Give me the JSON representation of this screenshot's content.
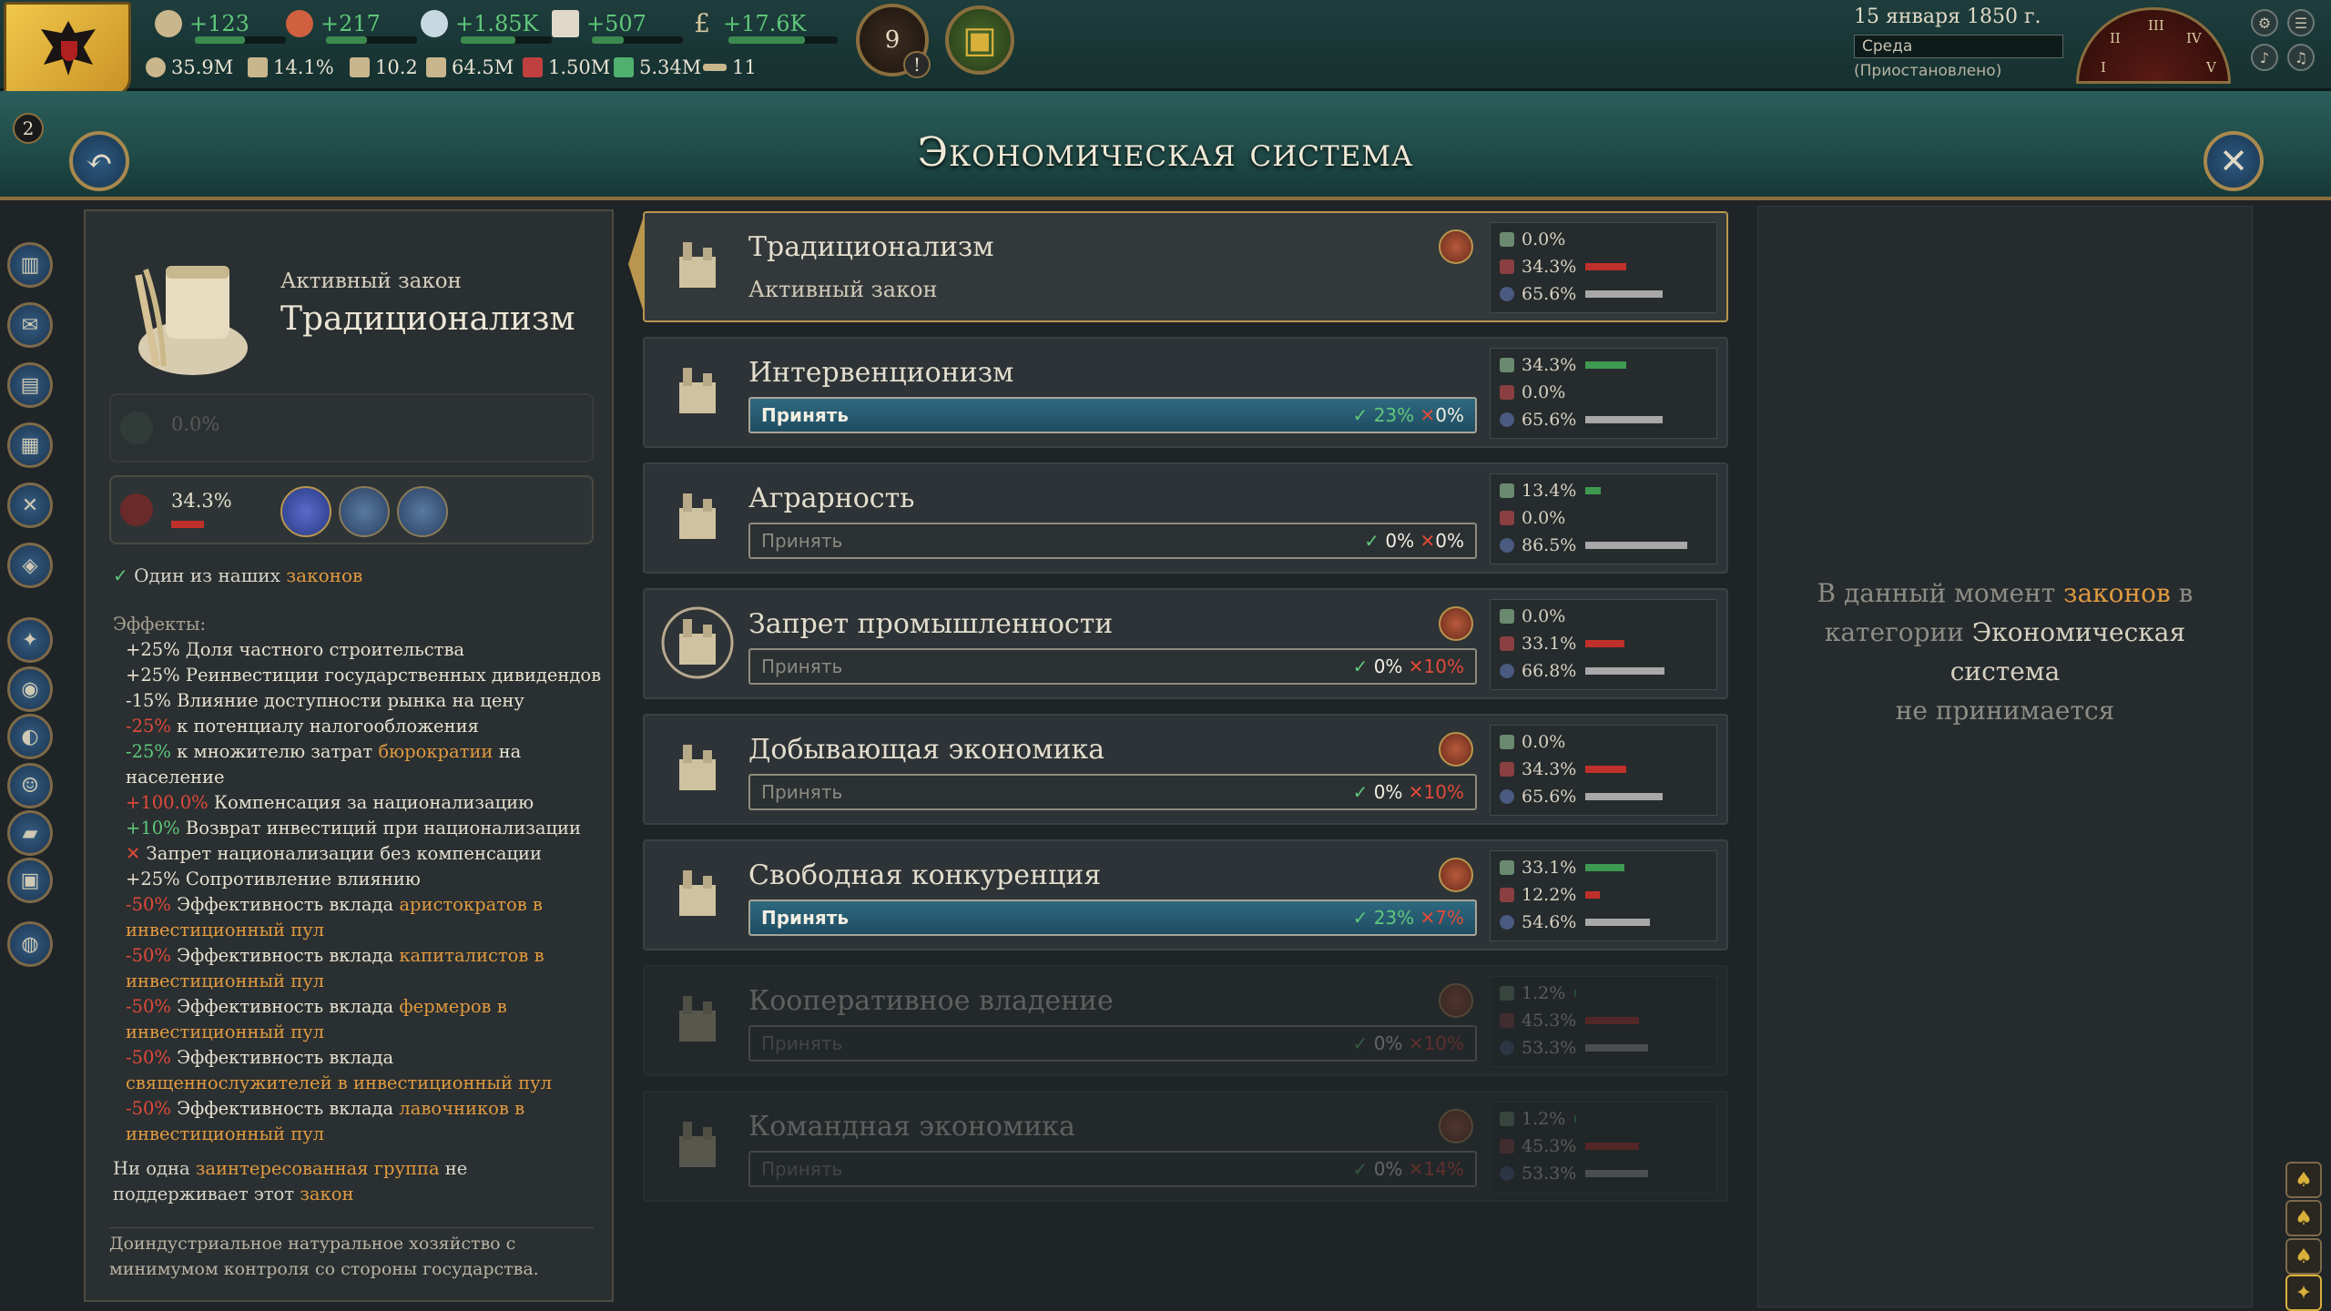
{
  "topbar": {
    "resources": [
      {
        "name": "authority-icon",
        "value": "+123"
      },
      {
        "name": "influence-icon",
        "value": "+217"
      },
      {
        "name": "diplomacy-icon",
        "value": "+1.85K"
      },
      {
        "name": "bureaucracy-icon",
        "value": "+507"
      },
      {
        "name": "money-icon",
        "value": "+17.6K"
      }
    ],
    "stats": [
      {
        "name": "gdp-icon",
        "value": "35.9M"
      },
      {
        "name": "literacy-icon",
        "value": "14.1%"
      },
      {
        "name": "sol-icon",
        "value": "10.2"
      },
      {
        "name": "population-icon",
        "value": "64.5M"
      },
      {
        "name": "manpower-icon",
        "value": "1.50M"
      },
      {
        "name": "prestige-icon",
        "value": "5.34M"
      },
      {
        "name": "army-icon",
        "value": "11"
      }
    ],
    "alert_count": "9",
    "alert_mark": "!",
    "date": "15 января 1850 г.",
    "weekday": "Среда",
    "status": "(Приостановлено)",
    "clock_marks": [
      "II",
      "III",
      "IV",
      "V",
      "I"
    ]
  },
  "page": {
    "title": "Экономическая система",
    "notifications": "2",
    "back_icon": "↶",
    "close_icon": "✕"
  },
  "left": {
    "active_label": "Активный закон",
    "active_name": "Традиционализм",
    "support_value": "0.0%",
    "oppose_value": "34.3%",
    "note_prefix": "Один из наших",
    "note_link": "законов",
    "effects_title": "Эффекты:",
    "effects": [
      {
        "v": "+25%",
        "t": " Доля частного строительства",
        "c": "pos"
      },
      {
        "v": "+25%",
        "t": " Реинвестиции государственных дивидендов",
        "c": "pos"
      },
      {
        "v": "-15%",
        "t": " Влияние доступности рынка на цену",
        "c": "pos"
      },
      {
        "v": "-25%",
        "t": " к потенциалу налогообложения",
        "c": "neg"
      },
      {
        "v": "-25%",
        "t": " к множителю затрат ",
        "link": "бюрократии",
        "after": " на население",
        "c": "grnv"
      },
      {
        "v": "+100.0%",
        "t": " Компенсация за национализацию",
        "c": "neg"
      },
      {
        "v": "+10%",
        "t": " Возврат инвестиций при национализации",
        "c": "grnv"
      },
      {
        "v": "✕",
        "t": " Запрет национализации без компенсации",
        "c": "neg"
      },
      {
        "v": "+25%",
        "t": " Сопротивление влиянию",
        "c": "pos"
      },
      {
        "v": "-50%",
        "t": " Эффективность вклада ",
        "link2": "аристократов в инвестиционный пул",
        "c": "neg"
      },
      {
        "v": "-50%",
        "t": " Эффективность вклада ",
        "link2": "капиталистов в инвестиционный пул",
        "c": "neg"
      },
      {
        "v": "-50%",
        "t": " Эффективность вклада ",
        "link2": "фермеров в инвестиционный пул",
        "c": "neg"
      },
      {
        "v": "-50%",
        "t": " Эффективность вклада ",
        "link2": "священнослужителей в инвестиционный пул",
        "c": "neg"
      },
      {
        "v": "-50%",
        "t": " Эффективность вклада ",
        "link2": "лавочников в инвестиционный пул",
        "c": "neg"
      }
    ],
    "ig_note_1": "Ни одна ",
    "ig_note_link": "заинтересованная группа",
    "ig_note_2": " не поддерживает этот ",
    "ig_note_link2": "закон",
    "description": "Доиндустриальное натуральное хозяйство с минимумом контроля со стороны государства."
  },
  "laws": [
    {
      "name": "Традиционализм",
      "sub": "Активный закон",
      "support": "0.0%",
      "oppose": "34.3%",
      "neutral": "65.6%",
      "support_frac": 0,
      "oppose_frac": 0.343,
      "neutral_frac": 0.656
    },
    {
      "name": "Интервенционизм",
      "enact": "Принять",
      "yes": "23%",
      "no": "0%",
      "support": "34.3%",
      "oppose": "0.0%",
      "neutral": "65.6%",
      "support_frac": 0.343,
      "oppose_frac": 0,
      "neutral_frac": 0.656
    },
    {
      "name": "Аграрность",
      "enact": "Принять",
      "yes": "0%",
      "no": "0%",
      "support": "13.4%",
      "oppose": "0.0%",
      "neutral": "86.5%",
      "support_frac": 0.134,
      "oppose_frac": 0,
      "neutral_frac": 0.865
    },
    {
      "name": "Запрет промышленности",
      "enact": "Принять",
      "yes": "0%",
      "no": "10%",
      "support": "0.0%",
      "oppose": "33.1%",
      "neutral": "66.8%",
      "support_frac": 0,
      "oppose_frac": 0.331,
      "neutral_frac": 0.668
    },
    {
      "name": "Добывающая экономика",
      "enact": "Принять",
      "yes": "0%",
      "no": "10%",
      "support": "0.0%",
      "oppose": "34.3%",
      "neutral": "65.6%",
      "support_frac": 0,
      "oppose_frac": 0.343,
      "neutral_frac": 0.656
    },
    {
      "name": "Свободная конкуренция",
      "enact": "Принять",
      "yes": "23%",
      "no": "7%",
      "support": "33.1%",
      "oppose": "12.2%",
      "neutral": "54.6%",
      "support_frac": 0.331,
      "oppose_frac": 0.122,
      "neutral_frac": 0.546
    },
    {
      "name": "Кооперативное владение",
      "enact": "Принять",
      "yes": "0%",
      "no": "10%",
      "support": "1.2%",
      "oppose": "45.3%",
      "neutral": "53.3%",
      "support_frac": 0.012,
      "oppose_frac": 0.453,
      "neutral_frac": 0.533
    },
    {
      "name": "Командная экономика",
      "enact": "Принять",
      "yes": "0%",
      "no": "14%",
      "support": "1.2%",
      "oppose": "45.3%",
      "neutral": "53.3%",
      "support_frac": 0.012,
      "oppose_frac": 0.453,
      "neutral_frac": 0.533
    }
  ],
  "right": {
    "t1": "В данный момент ",
    "link1": "законов",
    "t2": " в категории ",
    "link2": "Экономическая система",
    "t3": " не принимается"
  },
  "colors": {
    "support": "#3d9a50",
    "oppose": "#c0302a",
    "neutral": "#a8a8a8",
    "accent": "#e09a40"
  }
}
